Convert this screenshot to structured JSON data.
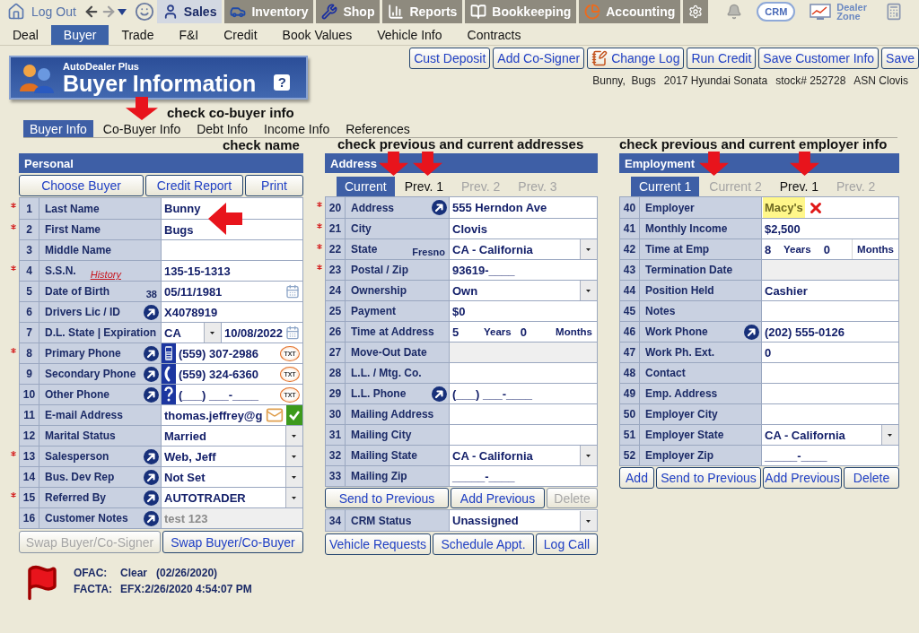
{
  "top_nav": {
    "logout": "Log Out",
    "tabs": [
      {
        "label": "Sales",
        "selected": true
      },
      {
        "label": "Inventory",
        "selected": false
      },
      {
        "label": "Shop",
        "selected": false
      },
      {
        "label": "Reports",
        "selected": false
      },
      {
        "label": "Bookkeeping",
        "selected": false
      },
      {
        "label": "Accounting",
        "selected": false
      }
    ],
    "crm": "CRM",
    "dealer_zone": "Dealer Zone"
  },
  "sub_nav": [
    {
      "label": "Deal",
      "selected": false
    },
    {
      "label": "Buyer",
      "selected": true
    },
    {
      "label": "Trade",
      "selected": false
    },
    {
      "label": "F&I",
      "selected": false
    },
    {
      "label": "Credit",
      "selected": false
    },
    {
      "label": "Book Values",
      "selected": false
    },
    {
      "label": "Vehicle Info",
      "selected": false
    },
    {
      "label": "Contracts",
      "selected": false
    }
  ],
  "header": {
    "brand": "AutoDealer Plus",
    "title": "Buyer Information",
    "help": "?"
  },
  "actions": [
    {
      "label": "Cust Deposit"
    },
    {
      "label": "Add Co-Signer"
    },
    {
      "label": "Change Log"
    },
    {
      "label": "Run Credit"
    },
    {
      "label": "Save Customer Info"
    },
    {
      "label": "Save"
    }
  ],
  "summary": [
    "Bunny,  Bugs",
    "2017 Hyundai Sonata",
    "stock# 252728",
    "ASN Clovis"
  ],
  "section_tabs": {
    "annotation": "check co-buyer info",
    "tabs": [
      {
        "label": "Buyer Info",
        "selected": true
      },
      {
        "label": "Co-Buyer Info",
        "selected": false
      },
      {
        "label": "Debt Info",
        "selected": false
      },
      {
        "label": "Income Info",
        "selected": false
      },
      {
        "label": "References",
        "selected": false
      }
    ]
  },
  "personal": {
    "title": "Personal",
    "annotation": "check name",
    "buttons": [
      {
        "label": "Choose Buyer",
        "disabled": false
      },
      {
        "label": "Credit Report",
        "disabled": false
      },
      {
        "label": "Print",
        "disabled": false
      }
    ],
    "rows": [
      {
        "num": "1",
        "label": "Last Name",
        "required": true,
        "link": false,
        "kind": "text",
        "value": "Bunny"
      },
      {
        "num": "2",
        "label": "First Name",
        "required": true,
        "link": false,
        "kind": "text",
        "value": "Bugs"
      },
      {
        "num": "3",
        "label": "Middle Name",
        "required": false,
        "link": false,
        "kind": "text"
      },
      {
        "num": "4",
        "label": "S.S.N.",
        "label_link": "History",
        "required": true,
        "link": false,
        "kind": "text",
        "value": "135-15-1313"
      },
      {
        "num": "5",
        "label": "Date of Birth",
        "hint": "38",
        "required": false,
        "link": false,
        "kind": "date",
        "value": "05/11/1981"
      },
      {
        "num": "6",
        "label": "Drivers Lic / ID",
        "required": false,
        "link": true,
        "kind": "text",
        "value": "X4078919"
      },
      {
        "num": "7",
        "label": "D.L. State | Expiration",
        "required": false,
        "link": false,
        "kind": "state_date",
        "value": "CA",
        "date": "10/08/2022"
      },
      {
        "num": "8",
        "label": "Primary Phone",
        "required": true,
        "link": true,
        "kind": "phone_mobile",
        "value": "(559) 307-2986",
        "sms": "TXT"
      },
      {
        "num": "9",
        "label": "Secondary Phone",
        "required": false,
        "link": true,
        "kind": "phone_landline",
        "value": "(559) 324-6360",
        "sms": "TXT"
      },
      {
        "num": "10",
        "label": "Other Phone",
        "required": false,
        "link": true,
        "kind": "phone_unknown",
        "value": "(___) ___-____",
        "sms": "TXT"
      },
      {
        "num": "11",
        "label": "E-mail Address",
        "required": false,
        "link": false,
        "kind": "email",
        "value": "thomas.jeffrey@g",
        "verified": true
      },
      {
        "num": "12",
        "label": "Marital Status",
        "required": false,
        "link": false,
        "kind": "select",
        "value": "Married"
      },
      {
        "num": "13",
        "label": "Salesperson",
        "required": true,
        "link": true,
        "kind": "select",
        "value": "Web, Jeff"
      },
      {
        "num": "14",
        "label": "Bus. Dev Rep",
        "required": false,
        "link": true,
        "kind": "select",
        "value": "Not Set"
      },
      {
        "num": "15",
        "label": "Referred By",
        "required": true,
        "link": true,
        "kind": "select",
        "value": "AUTOTRADER"
      },
      {
        "num": "16",
        "label": "Customer Notes",
        "required": false,
        "link": true,
        "kind": "readonly",
        "value": "test 123"
      }
    ],
    "footer_buttons": [
      {
        "label": "Swap Buyer/Co-Signer",
        "disabled": true
      },
      {
        "label": "Swap Buyer/Co-Buyer",
        "disabled": false
      }
    ]
  },
  "address": {
    "title": "Address",
    "annotation": "check previous and current addresses",
    "tabs": [
      {
        "label": "Current",
        "selected": true,
        "disabled": false
      },
      {
        "label": "Prev. 1",
        "selected": false,
        "disabled": false
      },
      {
        "label": "Prev. 2",
        "selected": false,
        "disabled": true
      },
      {
        "label": "Prev. 3",
        "selected": false,
        "disabled": true
      }
    ],
    "rows": [
      {
        "num": "20",
        "label": "Address",
        "required": true,
        "link": true,
        "kind": "text",
        "value": "555 Herndon Ave"
      },
      {
        "num": "21",
        "label": "City",
        "required": true,
        "link": false,
        "kind": "text",
        "value": "Clovis"
      },
      {
        "num": "22",
        "label": "State",
        "hint": "Fresno",
        "required": true,
        "link": false,
        "kind": "select",
        "value": "CA - California"
      },
      {
        "num": "23",
        "label": "Postal / Zip",
        "required": true,
        "link": false,
        "kind": "text",
        "value": "93619-____"
      },
      {
        "num": "24",
        "label": "Ownership",
        "required": false,
        "link": false,
        "kind": "select",
        "value": "Own"
      },
      {
        "num": "25",
        "label": "Payment",
        "required": false,
        "link": false,
        "kind": "text",
        "value": "$0"
      },
      {
        "num": "26",
        "label": "Time at Address",
        "required": false,
        "link": false,
        "kind": "duration",
        "years": "5",
        "years_label": "Years",
        "months": "0",
        "months_label": "Months"
      },
      {
        "num": "27",
        "label": "Move-Out Date",
        "required": false,
        "link": false,
        "kind": "readonly"
      },
      {
        "num": "28",
        "label": "L.L. / Mtg. Co.",
        "required": false,
        "link": false,
        "kind": "text"
      },
      {
        "num": "29",
        "label": "L.L. Phone",
        "required": false,
        "link": true,
        "kind": "text",
        "value": "(___) ___-____"
      },
      {
        "num": "30",
        "label": "Mailing Address",
        "required": false,
        "link": false,
        "kind": "text"
      },
      {
        "num": "31",
        "label": "Mailing City",
        "required": false,
        "link": false,
        "kind": "text"
      },
      {
        "num": "32",
        "label": "Mailing State",
        "required": false,
        "link": false,
        "kind": "select",
        "value": "CA - California"
      },
      {
        "num": "33",
        "label": "Mailing Zip",
        "required": false,
        "link": false,
        "kind": "text",
        "value": "_____-____"
      }
    ],
    "buttons": [
      {
        "label": "Send to Previous",
        "disabled": false
      },
      {
        "label": "Add Previous",
        "disabled": false
      },
      {
        "label": "Delete",
        "disabled": true
      }
    ],
    "crm_row": {
      "num": "34",
      "label": "CRM Status",
      "required": false,
      "link": false,
      "kind": "select",
      "value": "Unassigned"
    },
    "footer_buttons": [
      {
        "label": "Vehicle Requests",
        "disabled": false
      },
      {
        "label": "Schedule Appt.",
        "disabled": false
      },
      {
        "label": "Log Call",
        "disabled": false
      }
    ]
  },
  "employment": {
    "title": "Employment",
    "annotation": "check previous and current employer info",
    "tabs": [
      {
        "label": "Current 1",
        "selected": true,
        "disabled": false
      },
      {
        "label": "Current 2",
        "selected": false,
        "disabled": true
      },
      {
        "label": "Prev. 1",
        "selected": false,
        "disabled": false
      },
      {
        "label": "Prev. 2",
        "selected": false,
        "disabled": true
      }
    ],
    "rows": [
      {
        "num": "40",
        "label": "Employer",
        "required": false,
        "link": false,
        "kind": "flagged",
        "value": "Macy's"
      },
      {
        "num": "41",
        "label": "Monthly Income",
        "required": false,
        "link": false,
        "kind": "text",
        "value": "$2,500"
      },
      {
        "num": "42",
        "label": "Time at Emp",
        "required": false,
        "link": false,
        "kind": "duration_split",
        "years": "8",
        "years_label": "Years",
        "months": "0",
        "months_label": "Months"
      },
      {
        "num": "43",
        "label": "Termination Date",
        "required": false,
        "link": false,
        "kind": "readonly"
      },
      {
        "num": "44",
        "label": "Position Held",
        "required": false,
        "link": false,
        "kind": "text",
        "value": "Cashier"
      },
      {
        "num": "45",
        "label": "Notes",
        "required": false,
        "link": false,
        "kind": "text"
      },
      {
        "num": "46",
        "label": "Work Phone",
        "required": false,
        "link": true,
        "kind": "text",
        "value": "(202) 555-0126"
      },
      {
        "num": "47",
        "label": "Work Ph. Ext.",
        "required": false,
        "link": false,
        "kind": "text",
        "value": "0"
      },
      {
        "num": "48",
        "label": "Contact",
        "required": false,
        "link": false,
        "kind": "text"
      },
      {
        "num": "49",
        "label": "Emp. Address",
        "required": false,
        "link": false,
        "kind": "text"
      },
      {
        "num": "50",
        "label": "Employer City",
        "required": false,
        "link": false,
        "kind": "text"
      },
      {
        "num": "51",
        "label": "Employer State",
        "required": false,
        "link": false,
        "kind": "select",
        "value": "CA - California"
      },
      {
        "num": "52",
        "label": "Employer Zip",
        "required": false,
        "link": false,
        "kind": "text",
        "value": "_____-____"
      }
    ],
    "buttons": [
      {
        "label": "Add",
        "disabled": false
      },
      {
        "label": "Send to Previous",
        "disabled": false
      },
      {
        "label": "Add Previous",
        "disabled": false
      },
      {
        "label": "Delete",
        "disabled": false
      }
    ]
  },
  "compliance": [
    {
      "label": "OFAC:",
      "value": "Clear   (02/26/2020)"
    },
    {
      "label": "FACTA:",
      "value": "EFX:2/26/2020 4:54:07 PM"
    }
  ]
}
